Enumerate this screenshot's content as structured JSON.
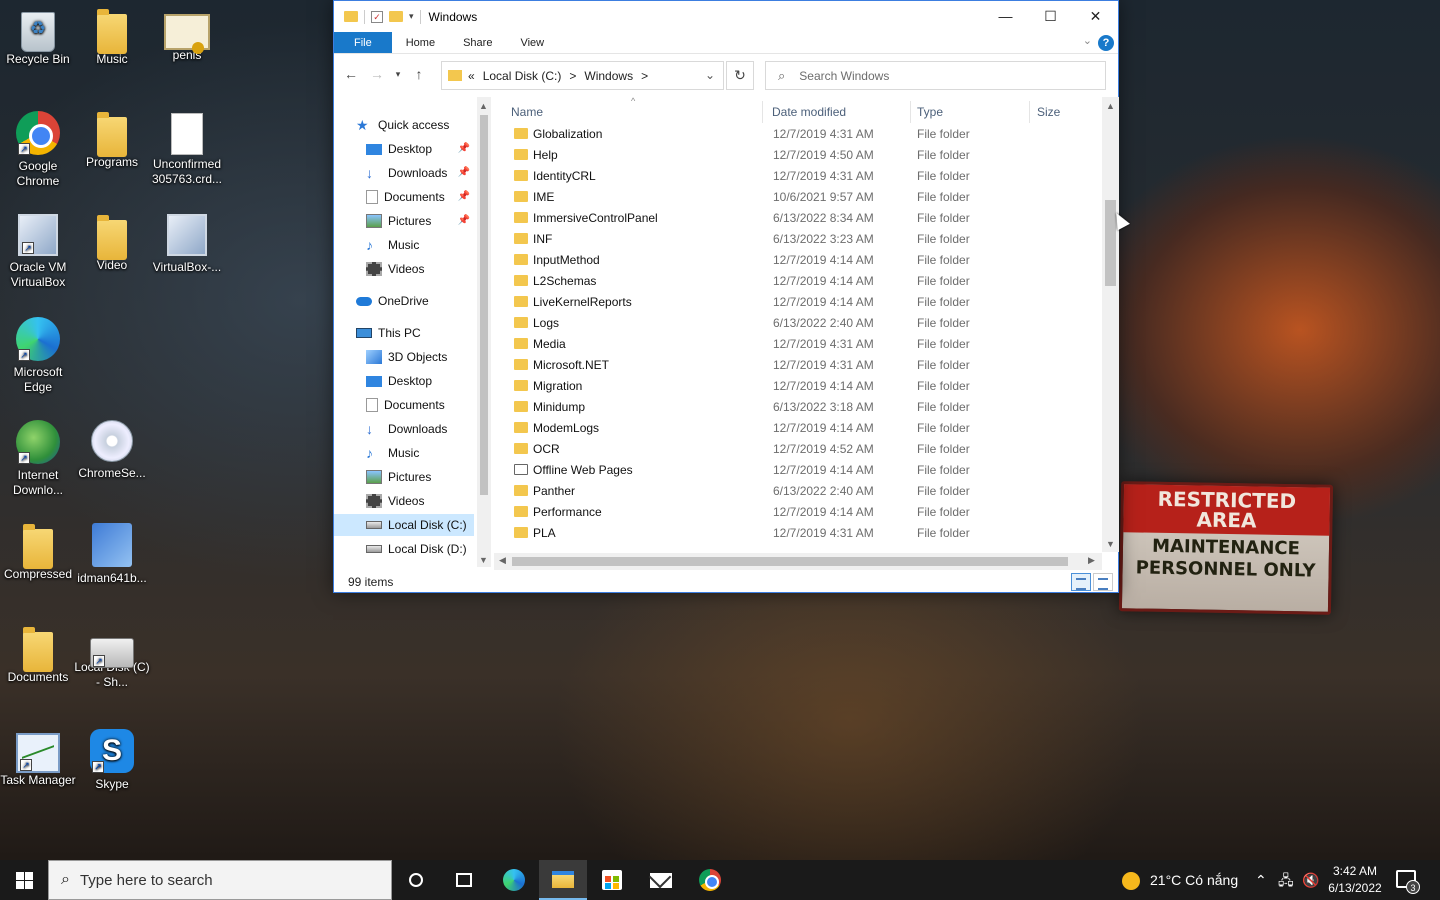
{
  "desktop": {
    "icons": [
      {
        "label": "Recycle Bin"
      },
      {
        "label": "Music"
      },
      {
        "label": "penis"
      },
      {
        "label": "Google Chrome"
      },
      {
        "label": "Programs"
      },
      {
        "label": "Unconfirmed 305763.crd..."
      },
      {
        "label": "Oracle VM VirtualBox"
      },
      {
        "label": "Video"
      },
      {
        "label": "VirtualBox-..."
      },
      {
        "label": "Microsoft Edge"
      },
      {
        "label": "Internet Downlo..."
      },
      {
        "label": "ChromeSe..."
      },
      {
        "label": "Compressed"
      },
      {
        "label": "idman641b..."
      },
      {
        "label": "Documents"
      },
      {
        "label": "Local Disk (C) - Sh..."
      },
      {
        "label": "Task Manager"
      },
      {
        "label": "Skype"
      }
    ],
    "sign": {
      "top": "RESTRICTED AREA",
      "bottom": "MAINTENANCE PERSONNEL ONLY"
    }
  },
  "window": {
    "title": "Windows",
    "ribbon_tabs": [
      "File",
      "Home",
      "Share",
      "View"
    ],
    "address": {
      "overflow": "«",
      "crumbs": [
        "Local Disk (C:)",
        "Windows"
      ],
      "separator": ">"
    },
    "search_placeholder": "Search Windows",
    "nav": [
      {
        "label": "Quick access",
        "icon": "star-icon",
        "pinned": false
      },
      {
        "label": "Desktop",
        "icon": "desktop-icon",
        "pinned": true
      },
      {
        "label": "Downloads",
        "icon": "download-icon",
        "pinned": true
      },
      {
        "label": "Documents",
        "icon": "document-icon",
        "pinned": true
      },
      {
        "label": "Pictures",
        "icon": "pictures-icon",
        "pinned": true
      },
      {
        "label": "Music",
        "icon": "music-icon",
        "pinned": false
      },
      {
        "label": "Videos",
        "icon": "videos-icon",
        "pinned": false
      },
      {
        "label": "OneDrive",
        "icon": "cloud-icon",
        "pinned": false
      },
      {
        "label": "This PC",
        "icon": "pc-icon",
        "pinned": false
      },
      {
        "label": "3D Objects",
        "icon": "3d-objects-icon",
        "pinned": false
      },
      {
        "label": "Desktop",
        "icon": "desktop-icon",
        "pinned": false
      },
      {
        "label": "Documents",
        "icon": "document-icon",
        "pinned": false
      },
      {
        "label": "Downloads",
        "icon": "download-icon",
        "pinned": false
      },
      {
        "label": "Music",
        "icon": "music-icon",
        "pinned": false
      },
      {
        "label": "Pictures",
        "icon": "pictures-icon",
        "pinned": false
      },
      {
        "label": "Videos",
        "icon": "videos-icon",
        "pinned": false
      },
      {
        "label": "Local Disk (C:)",
        "icon": "drive-icon",
        "pinned": false
      },
      {
        "label": "Local Disk (D:)",
        "icon": "drive-icon",
        "pinned": false
      }
    ],
    "columns": {
      "name": "Name",
      "date": "Date modified",
      "type": "Type",
      "size": "Size"
    },
    "files": [
      {
        "name": "Globalization",
        "date": "12/7/2019 4:31 AM",
        "type": "File folder"
      },
      {
        "name": "Help",
        "date": "12/7/2019 4:50 AM",
        "type": "File folder"
      },
      {
        "name": "IdentityCRL",
        "date": "12/7/2019 4:31 AM",
        "type": "File folder"
      },
      {
        "name": "IME",
        "date": "10/6/2021 9:57 AM",
        "type": "File folder"
      },
      {
        "name": "ImmersiveControlPanel",
        "date": "6/13/2022 8:34 AM",
        "type": "File folder"
      },
      {
        "name": "INF",
        "date": "6/13/2022 3:23 AM",
        "type": "File folder"
      },
      {
        "name": "InputMethod",
        "date": "12/7/2019 4:14 AM",
        "type": "File folder"
      },
      {
        "name": "L2Schemas",
        "date": "12/7/2019 4:14 AM",
        "type": "File folder"
      },
      {
        "name": "LiveKernelReports",
        "date": "12/7/2019 4:14 AM",
        "type": "File folder"
      },
      {
        "name": "Logs",
        "date": "6/13/2022 2:40 AM",
        "type": "File folder"
      },
      {
        "name": "Media",
        "date": "12/7/2019 4:31 AM",
        "type": "File folder"
      },
      {
        "name": "Microsoft.NET",
        "date": "12/7/2019 4:31 AM",
        "type": "File folder"
      },
      {
        "name": "Migration",
        "date": "12/7/2019 4:14 AM",
        "type": "File folder"
      },
      {
        "name": "Minidump",
        "date": "6/13/2022 3:18 AM",
        "type": "File folder"
      },
      {
        "name": "ModemLogs",
        "date": "12/7/2019 4:14 AM",
        "type": "File folder"
      },
      {
        "name": "OCR",
        "date": "12/7/2019 4:52 AM",
        "type": "File folder"
      },
      {
        "name": "Offline Web Pages",
        "date": "12/7/2019 4:14 AM",
        "type": "File folder"
      },
      {
        "name": "Panther",
        "date": "6/13/2022 2:40 AM",
        "type": "File folder"
      },
      {
        "name": "Performance",
        "date": "12/7/2019 4:14 AM",
        "type": "File folder"
      },
      {
        "name": "PLA",
        "date": "12/7/2019 4:31 AM",
        "type": "File folder"
      }
    ],
    "status": "99 items"
  },
  "taskbar": {
    "search_placeholder": "Type here to search",
    "weather": "21°C  Có nắng",
    "time": "3:42 AM",
    "date": "6/13/2022",
    "notification_count": "3"
  }
}
